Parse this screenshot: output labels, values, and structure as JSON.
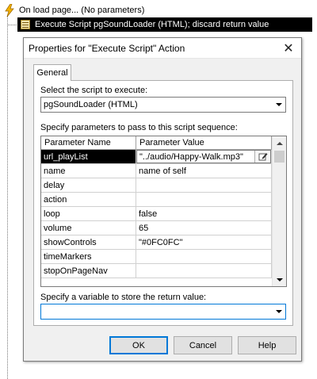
{
  "tree": {
    "event_label": "On load page... (No parameters)",
    "action_label": "Execute Script pgSoundLoader (HTML); discard return value"
  },
  "dialog": {
    "title": "Properties for \"Execute Script\" Action",
    "close_glyph": "✕",
    "tab_general": "General",
    "script_label": "Select the script to execute:",
    "script_value": "pgSoundLoader (HTML)",
    "params_label": "Specify parameters to pass to this script sequence:",
    "grid": {
      "col_name": "Parameter Name",
      "col_value": "Parameter Value",
      "rows": [
        {
          "name": "url_playList",
          "value": "\"../audio/Happy-Walk.mp3\""
        },
        {
          "name": "name",
          "value": "name of self"
        },
        {
          "name": "delay",
          "value": ""
        },
        {
          "name": "action",
          "value": ""
        },
        {
          "name": "loop",
          "value": "false"
        },
        {
          "name": "volume",
          "value": "65"
        },
        {
          "name": "showControls",
          "value": "\"#0FC0FC\""
        },
        {
          "name": "timeMarkers",
          "value": ""
        },
        {
          "name": "stopOnPageNav",
          "value": ""
        }
      ]
    },
    "return_label": "Specify a variable to store the return value:",
    "return_value": "",
    "buttons": {
      "ok": "OK",
      "cancel": "Cancel",
      "help": "Help"
    }
  },
  "colors": {
    "selection": "#000000",
    "focus_border": "#0078d7",
    "dialog_bg": "#f0f0f0"
  },
  "icons": {
    "event": "lightning-icon",
    "action": "script-icon",
    "edit": "pencil-edit-icon"
  }
}
